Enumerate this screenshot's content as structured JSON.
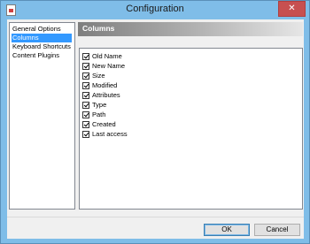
{
  "window": {
    "title": "Configuration",
    "close_glyph": "✕"
  },
  "nav": {
    "items": [
      {
        "label": "General Options",
        "selected": false
      },
      {
        "label": "Columns",
        "selected": true
      },
      {
        "label": "Keyboard Shortcuts",
        "selected": false
      },
      {
        "label": "Content Plugins",
        "selected": false
      }
    ]
  },
  "panel": {
    "title": "Columns"
  },
  "columns": [
    {
      "label": "Old Name",
      "checked": true
    },
    {
      "label": "New Name",
      "checked": true
    },
    {
      "label": "Size",
      "checked": true
    },
    {
      "label": "Modified",
      "checked": true
    },
    {
      "label": "Attributes",
      "checked": true
    },
    {
      "label": "Type",
      "checked": true
    },
    {
      "label": "Path",
      "checked": true
    },
    {
      "label": "Created",
      "checked": true
    },
    {
      "label": "Last access",
      "checked": true
    }
  ],
  "buttons": {
    "ok": "OK",
    "cancel": "Cancel"
  },
  "colors": {
    "titlebar": "#7fbde8",
    "selection": "#3399ff",
    "close": "#c75050"
  }
}
